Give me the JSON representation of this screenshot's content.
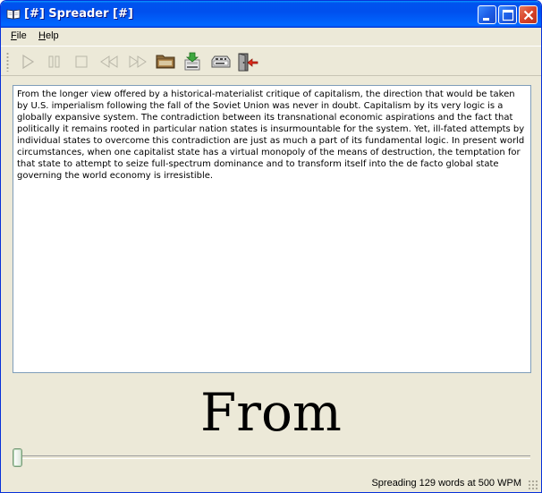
{
  "window": {
    "title": "[#] Spreader [#]",
    "icon": "book-icon",
    "controls": [
      "minimize-icon",
      "maximize-icon",
      "close-icon"
    ]
  },
  "menu": {
    "file": {
      "mnemonic": "F",
      "rest": "ile"
    },
    "help": {
      "mnemonic": "H",
      "rest": "elp"
    }
  },
  "toolbar": {
    "buttons": [
      {
        "name": "play",
        "icon": "play-icon",
        "enabled": false
      },
      {
        "name": "pause",
        "icon": "pause-icon",
        "enabled": false
      },
      {
        "name": "stop",
        "icon": "stop-icon",
        "enabled": false
      },
      {
        "name": "rewind",
        "icon": "rewind-icon",
        "enabled": false
      },
      {
        "name": "fast-forward",
        "icon": "fast-forward-icon",
        "enabled": false
      },
      {
        "name": "open",
        "icon": "folder-icon",
        "enabled": true
      },
      {
        "name": "download",
        "icon": "download-icon",
        "enabled": true
      },
      {
        "name": "settings",
        "icon": "device-icon",
        "enabled": true
      },
      {
        "name": "exit",
        "icon": "exit-door-icon",
        "enabled": true
      }
    ]
  },
  "text": "From the longer view offered by a historical-materialist critique of capitalism, the direction that would be taken by U.S. imperialism following the fall of the Soviet Union was never in doubt. Capitalism by its very logic is a globally expansive system. The contradiction between its transnational economic aspirations and the fact that politically it remains rooted in particular nation states is insurmountable for the system. Yet, ill-fated attempts by individual states to overcome this contradiction are just as much a part of its fundamental logic. In present world circumstances, when one capitalist state has a virtual monopoly of the means of destruction, the temptation for that state to attempt to seize full-spectrum dominance and to transform itself into the de facto global state governing the world economy is irresistible.",
  "current_word": "From",
  "progress": 0,
  "status": "Spreading 129 words at 500 WPM"
}
